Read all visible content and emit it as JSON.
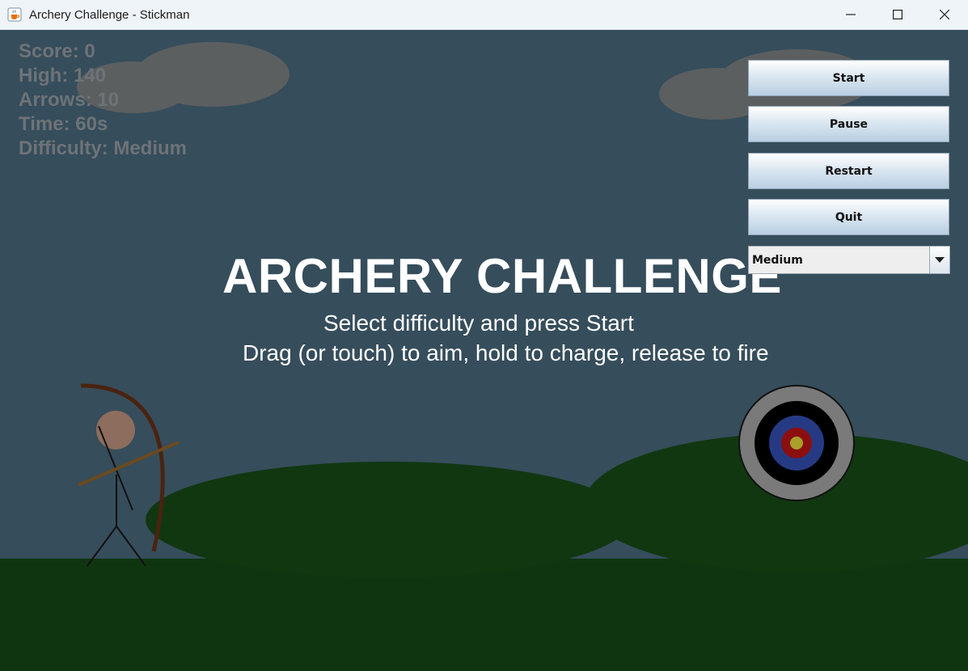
{
  "window": {
    "title": "Archery Challenge - Stickman",
    "app_icon": "java-cup-icon",
    "controls": [
      "minimize-icon",
      "maximize-icon",
      "close-icon"
    ]
  },
  "hud": {
    "score": "Score: 0",
    "high": "High: 140",
    "arrows": "Arrows: 10",
    "time": "Time: 60s",
    "difficulty": "Difficulty: Medium"
  },
  "overlay": {
    "title": "ARCHERY CHALLENGE",
    "line1": "Select difficulty and press Start",
    "line2": "Drag (or touch) to aim, hold to charge, release to fire"
  },
  "controls": {
    "start": "Start",
    "pause": "Pause",
    "restart": "Restart",
    "quit": "Quit",
    "difficulty_selected": "Medium"
  },
  "colors": {
    "sky": "#364d5b",
    "ground": "#0f3510",
    "hill": "#113711",
    "cloud": "#5c5f60",
    "hud_text": "#6d7378",
    "bow": "#4a2310",
    "arrow": "#6b4a1f",
    "head": "#8d6d5d",
    "target_outer": "#7a7a7a",
    "target_black": "#000000",
    "target_blue": "#263a84",
    "target_red": "#8c0f0f",
    "target_gold": "#a8a02a"
  }
}
